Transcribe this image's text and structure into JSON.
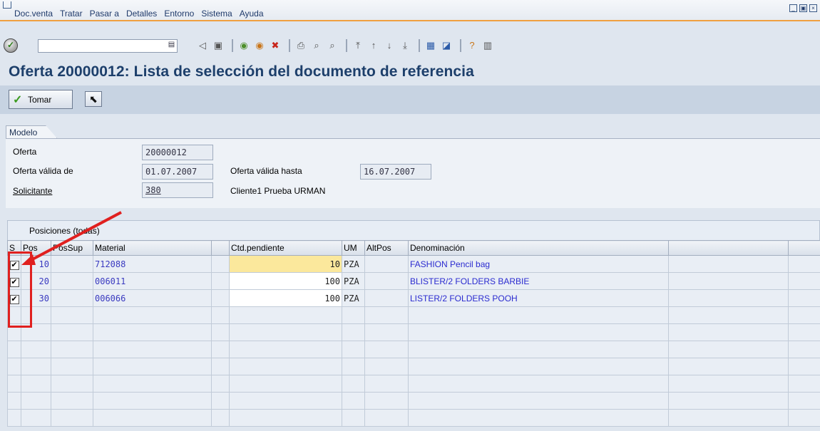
{
  "menu": [
    "Doc.venta",
    "Tratar",
    "Pasar a",
    "Detalles",
    "Entorno",
    "Sistema",
    "Ayuda"
  ],
  "title": "Oferta 20000012: Lista de selección del documento de referencia",
  "app_toolbar": {
    "tomar_label": "Tomar"
  },
  "header": {
    "tab_label": "Modelo",
    "oferta_label": "Oferta",
    "oferta_value": "20000012",
    "valida_de_label": "Oferta válida de",
    "valida_de_value": "01.07.2007",
    "valida_hasta_label": "Oferta válida hasta",
    "valida_hasta_value": "16.07.2007",
    "solicitante_label": "Solicitante",
    "solicitante_value": "380",
    "solicitante_name": "Cliente1 Prueba URMAN"
  },
  "table": {
    "caption": "Posiciones (todas)",
    "columns": [
      "S",
      "Pos",
      "PosSup",
      "Material",
      "Ctd.pendiente",
      "UM",
      "AltPos",
      "Denominación"
    ],
    "rows": [
      {
        "selected": true,
        "pos": "10",
        "possup": "",
        "material": "712088",
        "qty": "10",
        "um": "PZA",
        "altpos": "",
        "denom": "FASHION Pencil bag"
      },
      {
        "selected": true,
        "pos": "20",
        "possup": "",
        "material": "006011",
        "qty": "100",
        "um": "PZA",
        "altpos": "",
        "denom": "BLISTER/2 FOLDERS BARBIE"
      },
      {
        "selected": true,
        "pos": "30",
        "possup": "",
        "material": "006066",
        "qty": "100",
        "um": "PZA",
        "altpos": "",
        "denom": "LISTER/2 FOLDERS POOH"
      }
    ]
  },
  "colors": {
    "title": "#1d3f6b",
    "annotation": "#e0201f",
    "highlight": "#fbe89c"
  }
}
